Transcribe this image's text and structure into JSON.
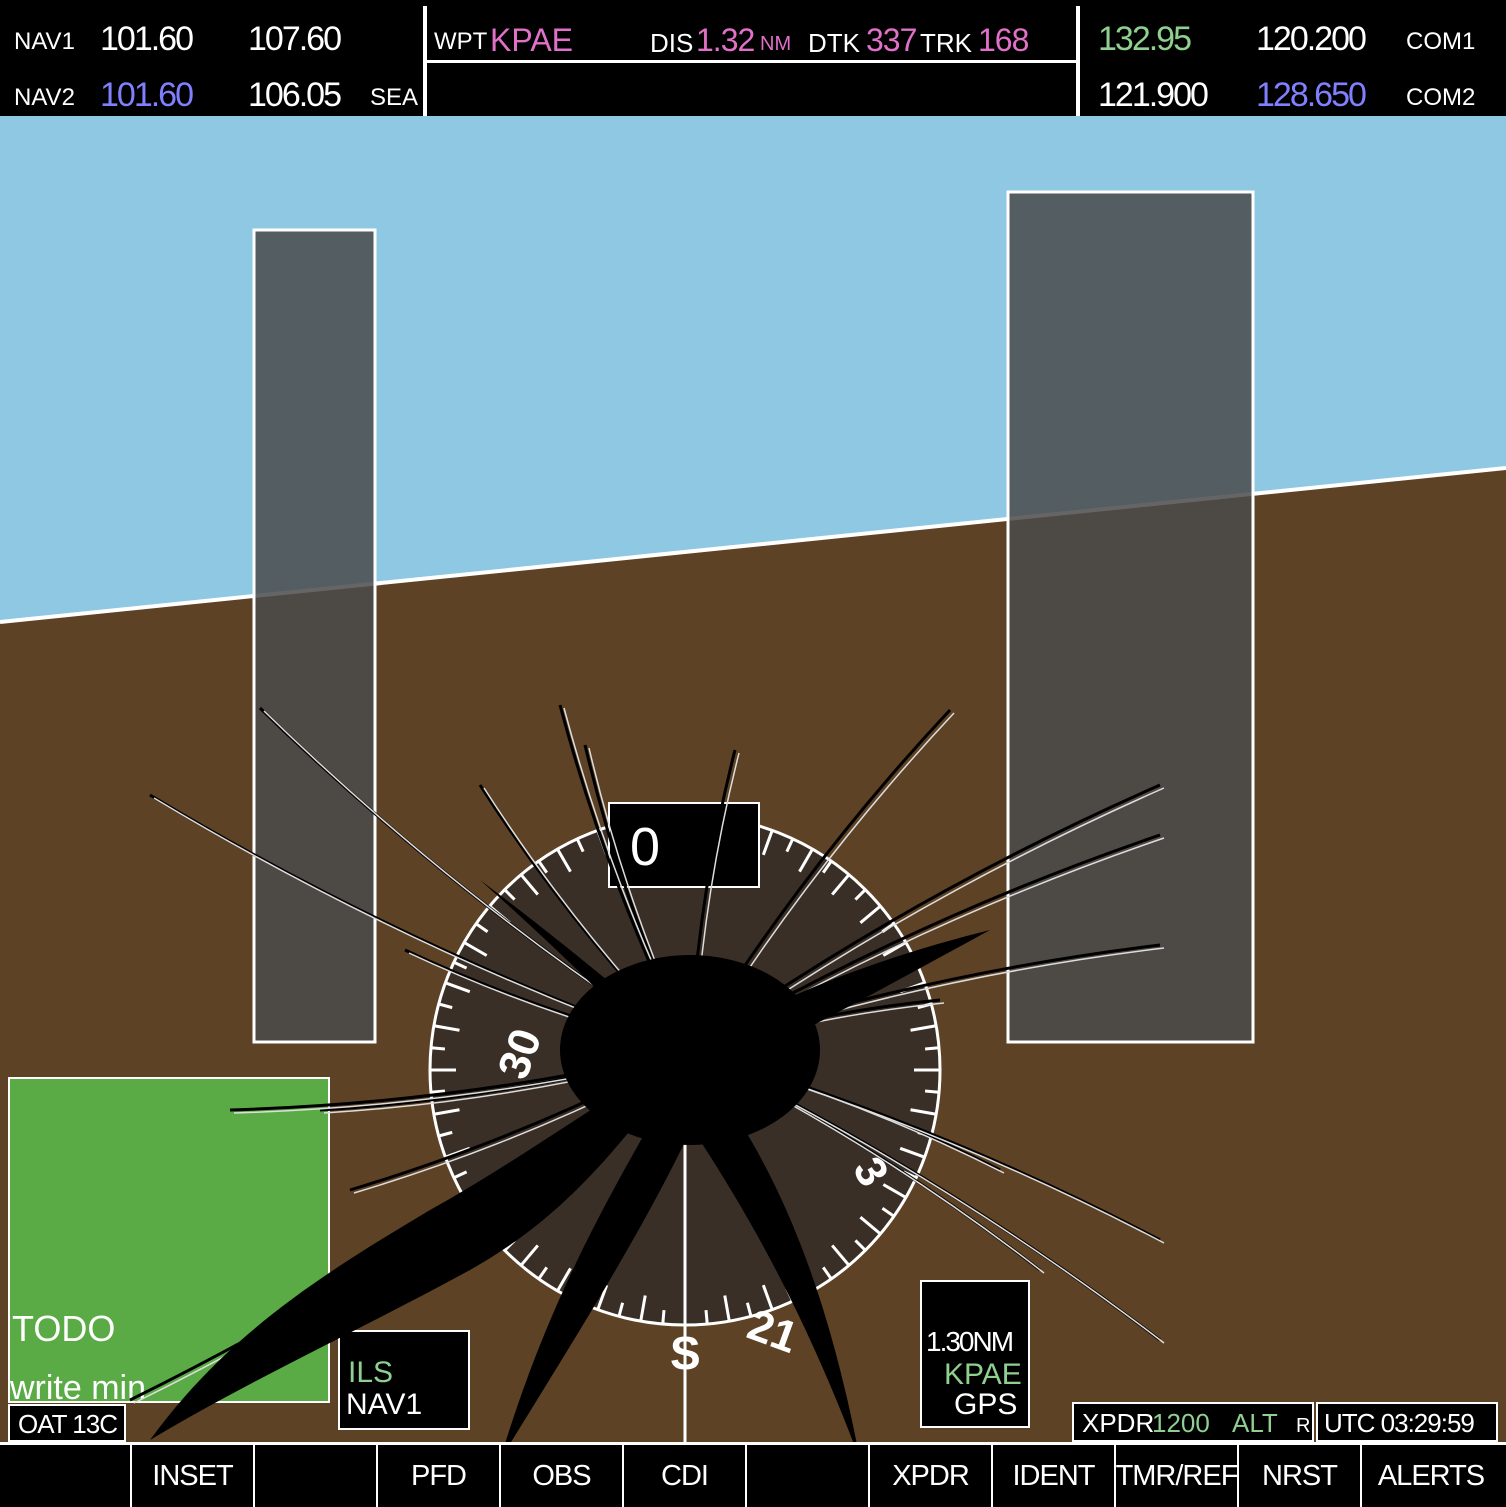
{
  "nav": {
    "nav1_label": "NAV1",
    "nav1_active": "101.60",
    "nav1_standby": "107.60",
    "nav2_label": "NAV2",
    "nav2_active": "101.60",
    "nav2_standby": "106.05",
    "nav2_ident": "SEA"
  },
  "waypoint": {
    "wpt_label": "WPT",
    "wpt_id": "KPAE",
    "dis_label": "DIS",
    "dis_value": "1.32",
    "dis_unit": "NM",
    "dtk_label": "DTK",
    "dtk_value": "337",
    "trk_label": "TRK",
    "trk_value": "168"
  },
  "com": {
    "com1_active": "132.95",
    "com1_standby": "120.200",
    "com1_label": "COM1",
    "com2_active": "121.900",
    "com2_standby": "128.650",
    "com2_label": "COM2"
  },
  "hsi": {
    "heading": "0",
    "cardinal_s": "S",
    "tick_21": "21",
    "tick_30": "30",
    "tick_3": "3",
    "source_top": "ILS",
    "source_bottom": "NAV1",
    "gps_dist": "1.30NM",
    "gps_wpt": "KPAE",
    "gps_label": "GPS"
  },
  "inset": {
    "line1": "TODO",
    "line2": "write  min"
  },
  "status": {
    "oat": "OAT 13C",
    "xpdr_label": "XPDR",
    "xpdr_code": "1200",
    "xpdr_mode": "ALT",
    "xpdr_reply": "R",
    "utc": "UTC 03:29:59"
  },
  "softkeys": [
    "",
    "INSET",
    "",
    "PFD",
    "OBS",
    "CDI",
    "",
    "XPDR",
    "IDENT",
    "TMR/REF",
    "NRST",
    "ALERTS"
  ],
  "colors": {
    "sky": "#8fc8e2",
    "ground": "#5e4225",
    "magenta": "#e070c8",
    "cyan_blue": "#8080ff",
    "green": "#8fcf8f",
    "inset_green": "#5aab45"
  }
}
